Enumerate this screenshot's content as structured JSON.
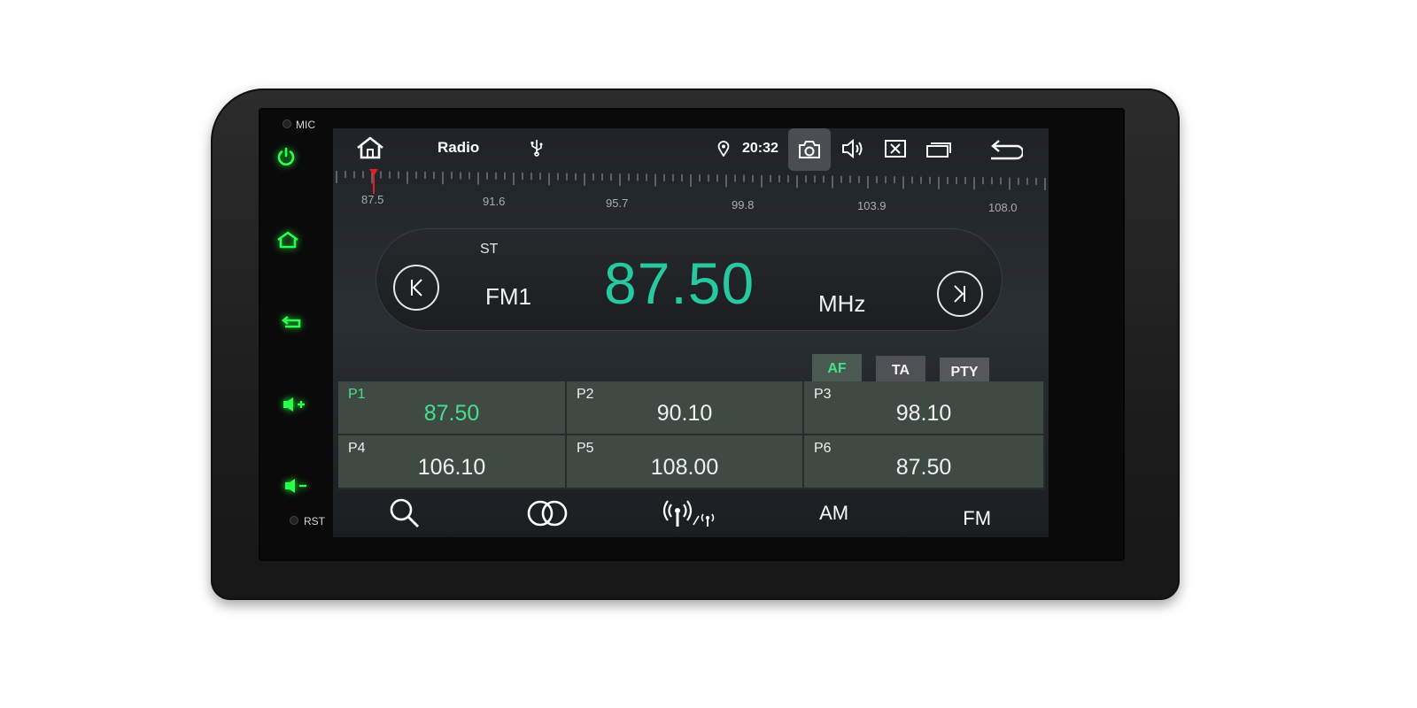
{
  "hardware": {
    "mic_label": "MIC",
    "rst_label": "RST",
    "keys": [
      {
        "name": "power-icon"
      },
      {
        "name": "home-icon"
      },
      {
        "name": "back-icon"
      },
      {
        "name": "volume-up-icon"
      },
      {
        "name": "volume-down-icon"
      }
    ],
    "key_glow_color": "#22ff44"
  },
  "statusbar": {
    "title": "Radio",
    "time": "20:32",
    "icons": [
      "home-icon",
      "usb-icon",
      "location-icon",
      "camera-icon",
      "volume-icon",
      "close-box-icon",
      "recent-apps-icon",
      "back-arrow-icon"
    ]
  },
  "scale": {
    "labels": [
      "87.5",
      "91.6",
      "95.7",
      "99.8",
      "103.9",
      "108.0"
    ],
    "min": 87.5,
    "max": 108.0,
    "current": 87.5,
    "marker_color": "#e02020"
  },
  "tuner": {
    "stereo": "ST",
    "band": "FM1",
    "frequency": "87.50",
    "unit": "MHz",
    "frequency_color": "#27c9a0"
  },
  "rds": {
    "af": "AF",
    "ta": "TA",
    "pty": "PTY",
    "af_active": true,
    "active_color": "#46e08a"
  },
  "presets": [
    {
      "name": "P1",
      "freq": "87.50",
      "active": true
    },
    {
      "name": "P2",
      "freq": "90.10",
      "active": false
    },
    {
      "name": "P3",
      "freq": "98.10",
      "active": false
    },
    {
      "name": "P4",
      "freq": "106.10",
      "active": false
    },
    {
      "name": "P5",
      "freq": "108.00",
      "active": false
    },
    {
      "name": "P6",
      "freq": "87.50",
      "active": false
    }
  ],
  "bottom_bar": {
    "search_icon": "search-icon",
    "stereo_icon": "stereo-icon",
    "local_distant_icon": "antenna-icon",
    "am": "AM",
    "fm": "FM"
  }
}
